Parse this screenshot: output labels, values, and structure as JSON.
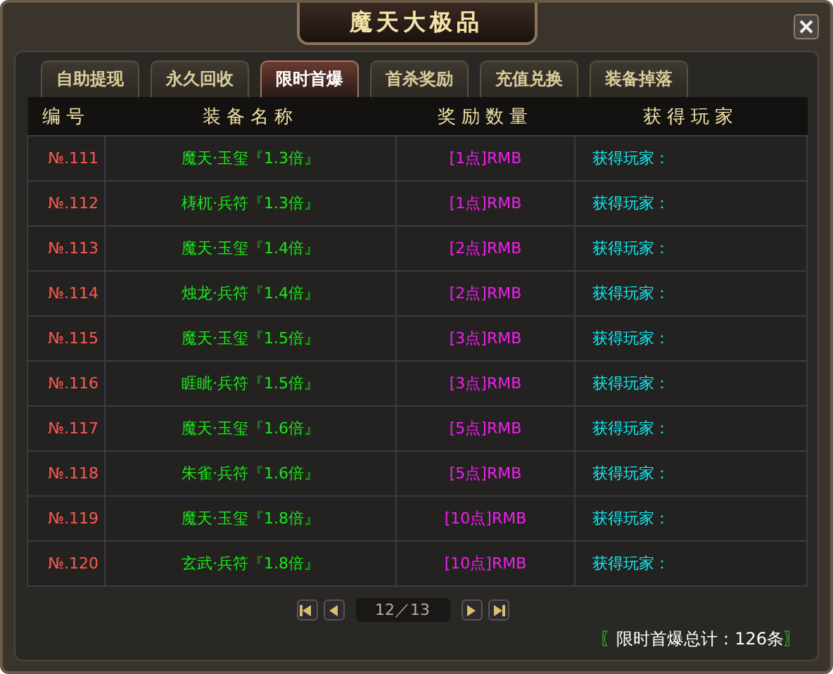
{
  "window": {
    "title": "魔天大极品"
  },
  "tabs": [
    {
      "label": "自助提现",
      "selected": false
    },
    {
      "label": "永久回收",
      "selected": false
    },
    {
      "label": "限时首爆",
      "selected": true
    },
    {
      "label": "首杀奖励",
      "selected": false
    },
    {
      "label": "充值兑换",
      "selected": false
    },
    {
      "label": "装备掉落",
      "selected": false
    }
  ],
  "table": {
    "columns": [
      "编号",
      "装备名称",
      "奖励数量",
      "获得玩家"
    ],
    "rows": [
      {
        "number": "№.111",
        "item": "魔天·玉玺『1.3倍』",
        "reward": "[1点]RMB",
        "player": "获得玩家："
      },
      {
        "number": "№.112",
        "item": "梼杌·兵符『1.3倍』",
        "reward": "[1点]RMB",
        "player": "获得玩家："
      },
      {
        "number": "№.113",
        "item": "魔天·玉玺『1.4倍』",
        "reward": "[2点]RMB",
        "player": "获得玩家："
      },
      {
        "number": "№.114",
        "item": "烛龙·兵符『1.4倍』",
        "reward": "[2点]RMB",
        "player": "获得玩家："
      },
      {
        "number": "№.115",
        "item": "魔天·玉玺『1.5倍』",
        "reward": "[3点]RMB",
        "player": "获得玩家："
      },
      {
        "number": "№.116",
        "item": "睚眦·兵符『1.5倍』",
        "reward": "[3点]RMB",
        "player": "获得玩家："
      },
      {
        "number": "№.117",
        "item": "魔天·玉玺『1.6倍』",
        "reward": "[5点]RMB",
        "player": "获得玩家："
      },
      {
        "number": "№.118",
        "item": "朱雀·兵符『1.6倍』",
        "reward": "[5点]RMB",
        "player": "获得玩家："
      },
      {
        "number": "№.119",
        "item": "魔天·玉玺『1.8倍』",
        "reward": "[10点]RMB",
        "player": "获得玩家："
      },
      {
        "number": "№.120",
        "item": "玄武·兵符『1.8倍』",
        "reward": "[10点]RMB",
        "player": "获得玩家："
      }
    ]
  },
  "pager": {
    "page": "12／13"
  },
  "summary": {
    "open": "〖",
    "text": "限时首爆总计：126条",
    "close": "〗"
  }
}
